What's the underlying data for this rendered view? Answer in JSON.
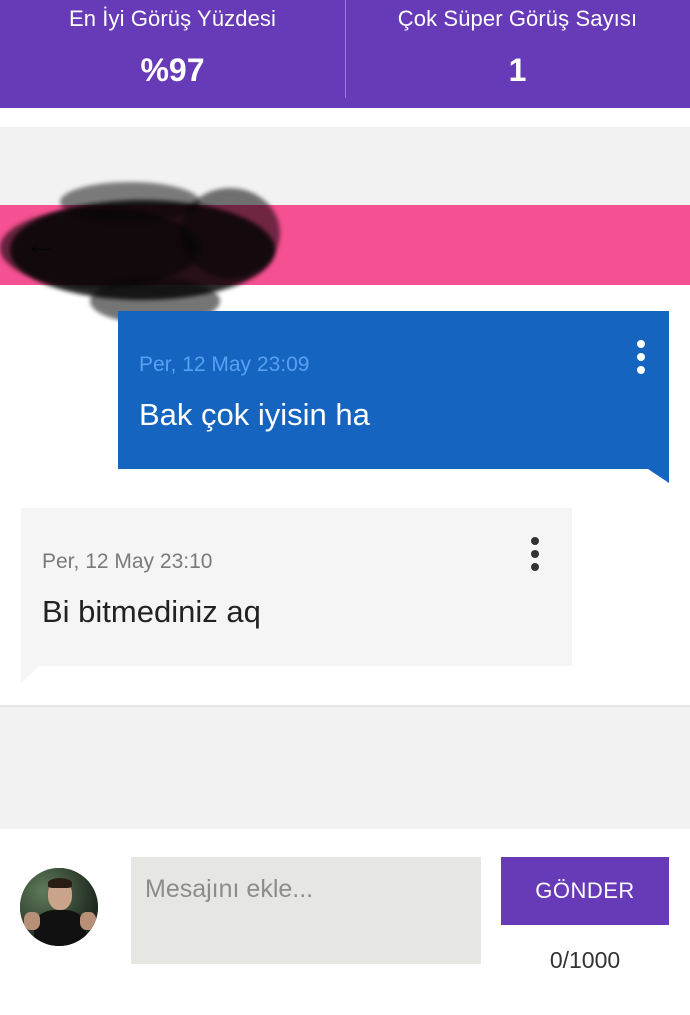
{
  "stats": {
    "best_view_label": "En İyi Görüş Yüzdesi",
    "best_view_value": "%97",
    "super_view_label": "Çok Süper Görüş Sayısı",
    "super_view_value": "1"
  },
  "colors": {
    "header_purple": "#673ab7",
    "banner_pink": "#f55091",
    "outgoing_blue": "#1565c0",
    "incoming_gray": "#f5f5f5"
  },
  "banner": {
    "back_icon": "arrow-left-icon"
  },
  "messages": [
    {
      "direction": "outgoing",
      "time": "Per, 12 May 23:09",
      "text": "Bak çok iyisin ha",
      "menu_icon": "more-vertical-icon"
    },
    {
      "direction": "incoming",
      "time": "Per, 12 May 23:10",
      "text": "Bi bitmediniz aq",
      "menu_icon": "more-vertical-icon"
    }
  ],
  "composer": {
    "placeholder": "Mesajını ekle...",
    "value": "",
    "send_label": "GÖNDER",
    "counter": "0/1000"
  }
}
